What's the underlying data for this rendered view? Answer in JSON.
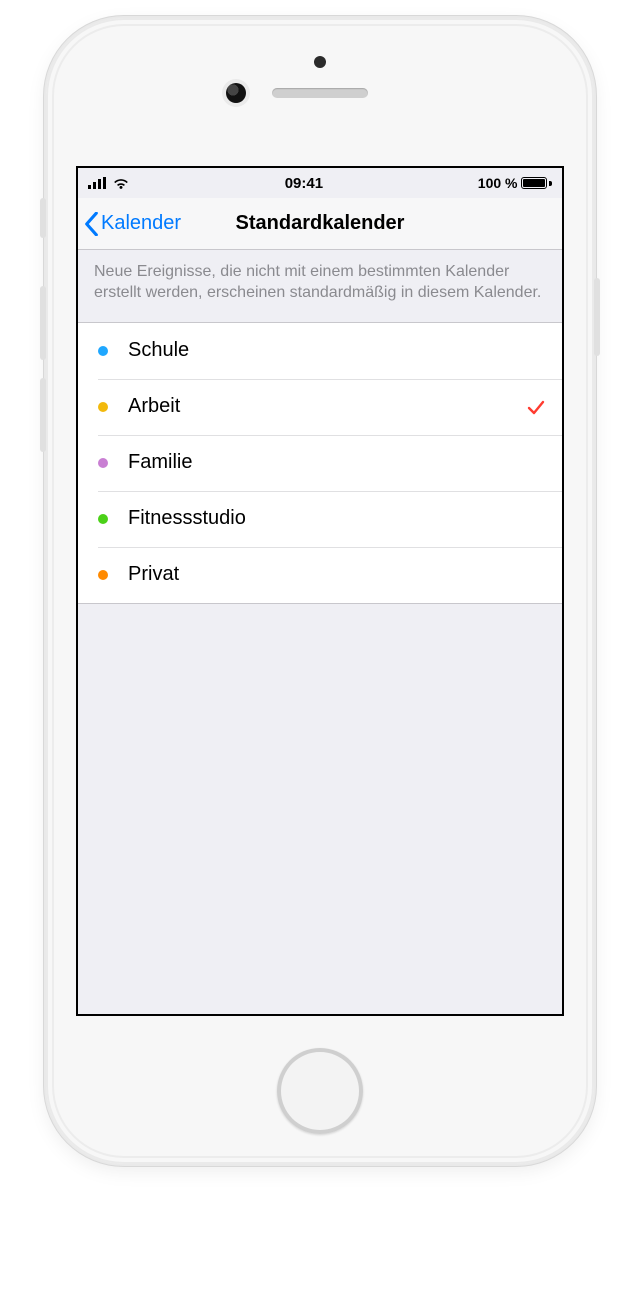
{
  "status": {
    "time": "09:41",
    "battery_text": "100 %"
  },
  "nav": {
    "back_label": "Kalender",
    "title": "Standardkalender"
  },
  "description": "Neue Ereignisse, die nicht mit einem bestimmten Kalender erstellt werden, erscheinen standardmäßig in diesem Kalender.",
  "calendars": [
    {
      "label": "Schule",
      "color": "#1fa7ff",
      "selected": false
    },
    {
      "label": "Arbeit",
      "color": "#f2b90c",
      "selected": true
    },
    {
      "label": "Familie",
      "color": "#c97fd3",
      "selected": false
    },
    {
      "label": "Fitnessstudio",
      "color": "#4bd118",
      "selected": false
    },
    {
      "label": "Privat",
      "color": "#ff8a00",
      "selected": false
    }
  ]
}
